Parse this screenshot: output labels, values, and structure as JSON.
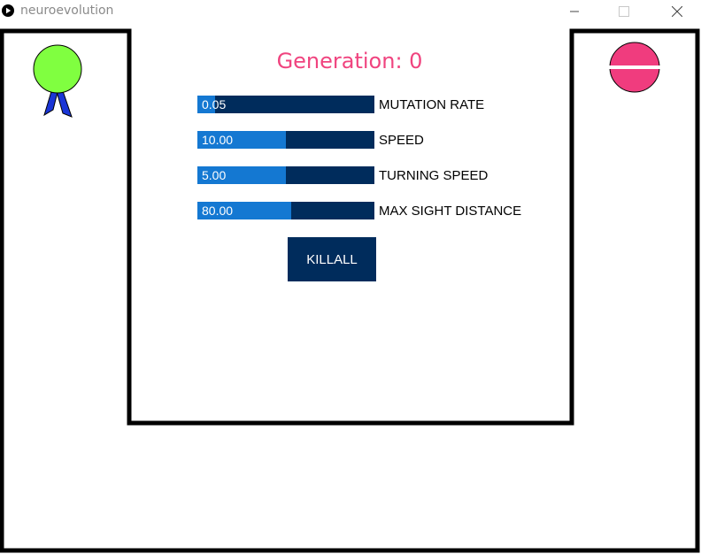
{
  "window": {
    "title": "neuroevolution",
    "icon": "play-circle-icon"
  },
  "generation": {
    "label": "Generation: 0",
    "value": 0
  },
  "sliders": [
    {
      "label": "MUTATION RATE",
      "value_text": "0.05",
      "fraction": 0.1
    },
    {
      "label": "SPEED",
      "value_text": "10.00",
      "fraction": 0.5
    },
    {
      "label": "TURNING SPEED",
      "value_text": "5.00",
      "fraction": 0.5
    },
    {
      "label": "MAX SIGHT DISTANCE",
      "value_text": "80.00",
      "fraction": 0.53
    }
  ],
  "killall_button": {
    "label": "KILLALL"
  },
  "colors": {
    "accent_text": "#f0447f",
    "slider_track": "#002c5c",
    "slider_fill": "#1478d2",
    "agent_body": "#80ff40",
    "agent_ribbon": "#1a35d6",
    "target": "#f03c7e"
  }
}
